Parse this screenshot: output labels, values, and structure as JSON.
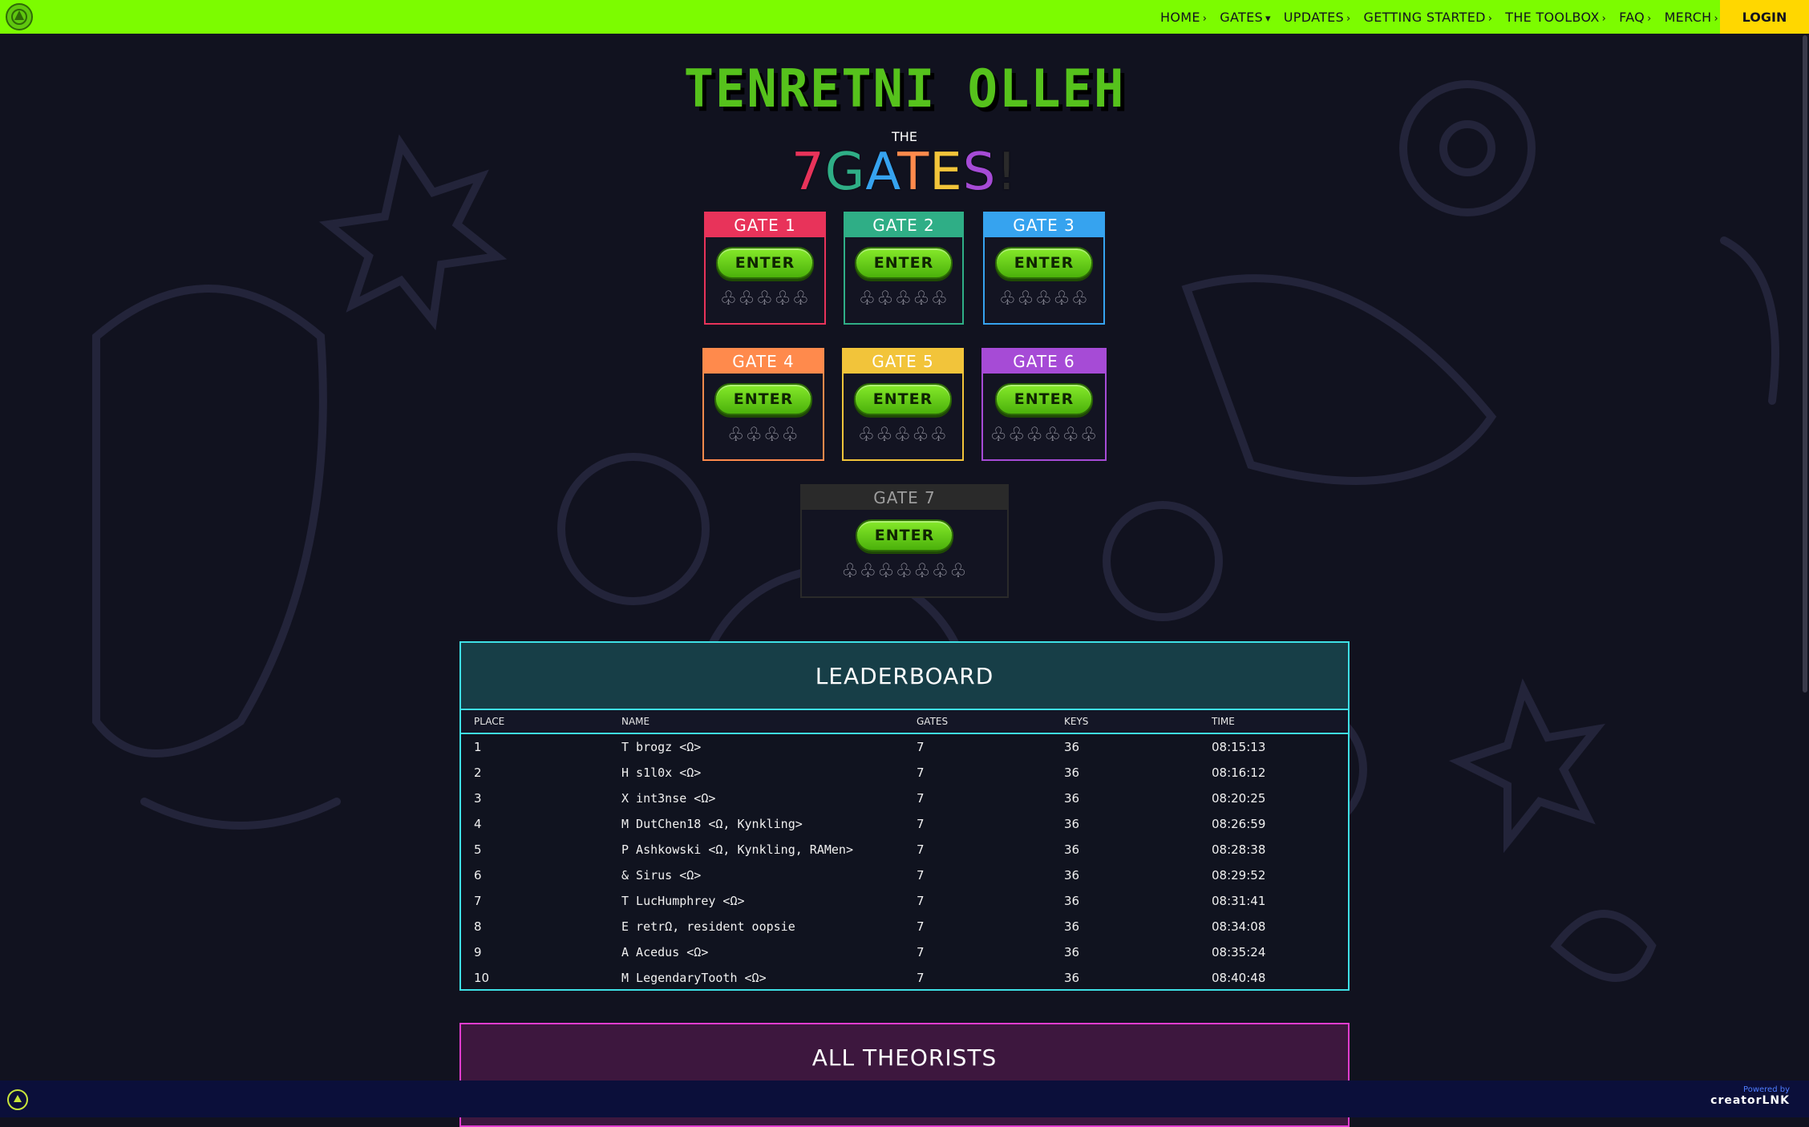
{
  "nav": {
    "items": [
      "HOME",
      "GATES",
      "UPDATES",
      "GETTING STARTED",
      "THE TOOLBOX",
      "FAQ",
      "MERCH"
    ],
    "chevrons": [
      "›",
      "▾",
      "›",
      "›",
      "›",
      "›",
      "›"
    ],
    "login": "LOGIN"
  },
  "hero": {
    "title": "TENRETNI OLLEH",
    "the": "THE",
    "gates_letters": [
      "7",
      "G",
      "A",
      "T",
      "E",
      "S",
      "!"
    ],
    "gates_colors": [
      "#e8335a",
      "#2fae86",
      "#36a3ef",
      "#ff8a4c",
      "#f2c43a",
      "#a64bd6",
      "#2a2a2a"
    ]
  },
  "gates": [
    {
      "label": "GATE 1",
      "enter": "ENTER",
      "keys": "♧♧♧♧♧",
      "color": "#e8335a"
    },
    {
      "label": "GATE 2",
      "enter": "ENTER",
      "keys": "♧♧♧♧♧",
      "color": "#2fae86"
    },
    {
      "label": "GATE 3",
      "enter": "ENTER",
      "keys": "♧♧♧♧♧",
      "color": "#36a3ef"
    },
    {
      "label": "GATE 4",
      "enter": "ENTER",
      "keys": "♧♧♧♧",
      "color": "#ff8a4c"
    },
    {
      "label": "GATE 5",
      "enter": "ENTER",
      "keys": "♧♧♧♧♧",
      "color": "#f2c43a"
    },
    {
      "label": "GATE 6",
      "enter": "ENTER",
      "keys": "♧♧♧♧♧♧",
      "color": "#a64bd6"
    },
    {
      "label": "GATE 7",
      "enter": "ENTER",
      "keys": "♧♧♧♧♧♧♧",
      "color": "#2a2a2a"
    }
  ],
  "leaderboard": {
    "title": "LEADERBOARD",
    "columns": [
      "PLACE",
      "NAME",
      "GATES",
      "KEYS",
      "TIME"
    ],
    "rows": [
      [
        "1",
        "T brogz <Ω>",
        "7",
        "36",
        "08:15:13"
      ],
      [
        "2",
        "H s1l0x <Ω>",
        "7",
        "36",
        "08:16:12"
      ],
      [
        "3",
        "X int3nse <Ω>",
        "7",
        "36",
        "08:20:25"
      ],
      [
        "4",
        "M DutChen18 <Ω, Kynkling>",
        "7",
        "36",
        "08:26:59"
      ],
      [
        "5",
        "P Ashkowski <Ω, Kynkling, RAMen>",
        "7",
        "36",
        "08:28:38"
      ],
      [
        "6",
        "& Sirus <Ω>",
        "7",
        "36",
        "08:29:52"
      ],
      [
        "7",
        "T LucHumphrey <Ω>",
        "7",
        "36",
        "08:31:41"
      ],
      [
        "8",
        "E retrΩ, resident oopsie",
        "7",
        "36",
        "08:34:08"
      ],
      [
        "9",
        "A Acedus <Ω>",
        "7",
        "36",
        "08:35:24"
      ],
      [
        "10",
        "M LegendaryTooth <Ω>",
        "7",
        "36",
        "08:40:48"
      ]
    ]
  },
  "theorists": {
    "title": "ALL THEORISTS"
  },
  "footer": {
    "powered_by": "Powered by",
    "brand": "creatorLNK"
  }
}
